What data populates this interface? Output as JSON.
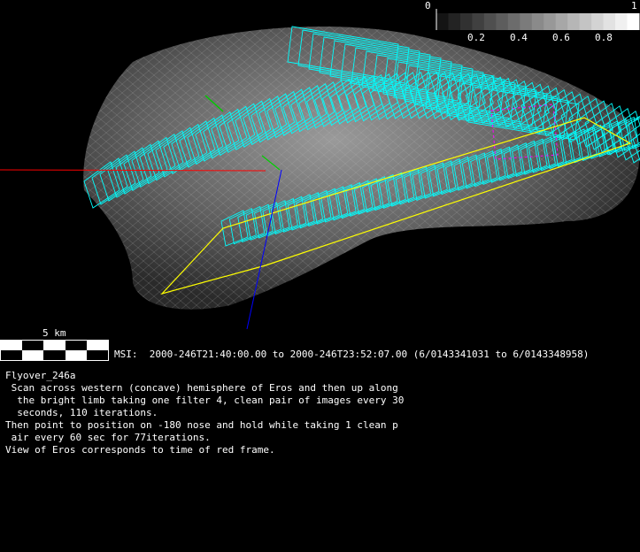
{
  "colorbar": {
    "min_label": "0",
    "max_label": "1",
    "ticks": [
      "0.2",
      "0.4",
      "0.6",
      "0.8"
    ],
    "steps": 17
  },
  "scale": {
    "label": "5 km"
  },
  "msi_line": "MSI:  2000-246T21:40:00.00 to 2000-246T23:52:07.00 (6/0143341031 to 6/0143348958)",
  "description": {
    "title": "Flyover_246a",
    "lines": [
      " Scan across western (concave) hemisphere of Eros and then up along",
      "  the bright limb taking one filter 4, clean pair of images every 30",
      "  seconds, 110 iterations.",
      "Then point to position on -180 nose and hold while taking 1 clean p",
      " air every 60 sec for 77iterations.",
      "View of Eros corresponds to time of red frame."
    ]
  },
  "colors": {
    "frames": "#00ffff",
    "footprint": "#ffff00",
    "red_frame": "#ff0000",
    "axis_blue": "#0000ff",
    "axis_green": "#00cc00",
    "magenta": "#ff00ff"
  }
}
